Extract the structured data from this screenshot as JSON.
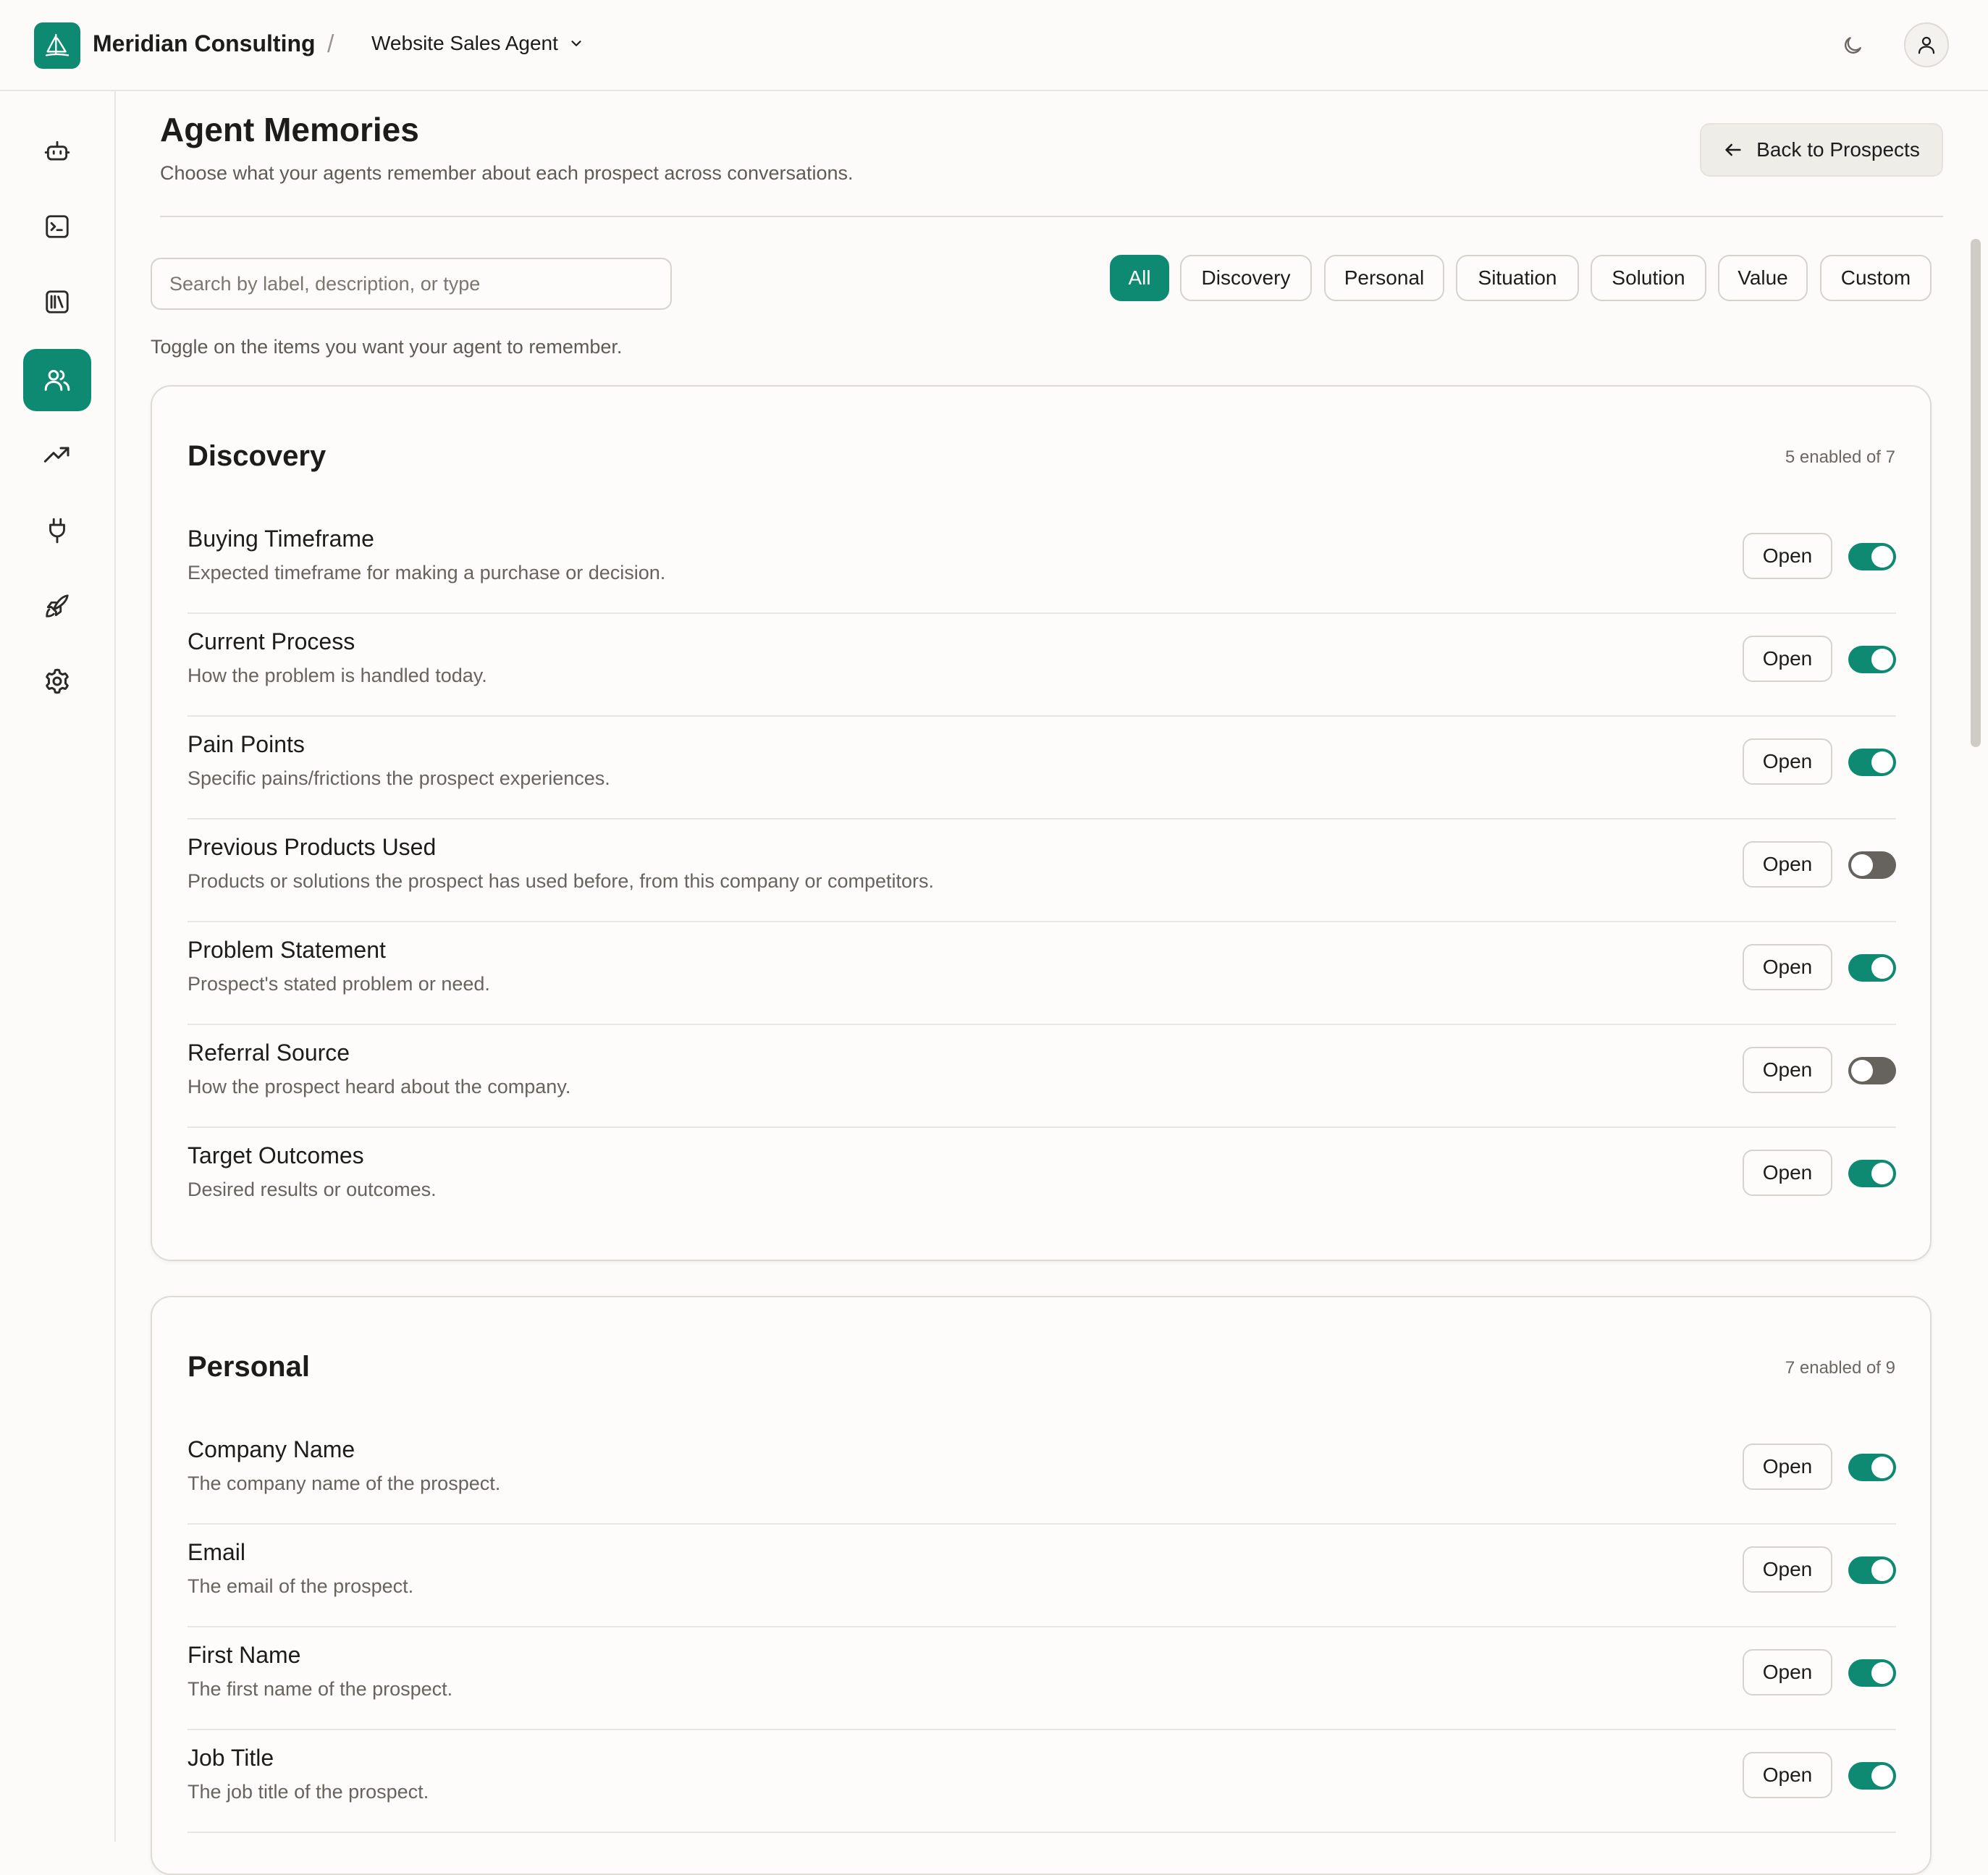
{
  "header": {
    "org_name": "Meridian Consulting",
    "separator": "/",
    "agent_name": "Website Sales Agent"
  },
  "sidebar": {
    "items": [
      {
        "icon": "bot-icon",
        "active": false
      },
      {
        "icon": "terminal-icon",
        "active": false
      },
      {
        "icon": "library-icon",
        "active": false
      },
      {
        "icon": "users-icon",
        "active": true
      },
      {
        "icon": "trending-up-icon",
        "active": false
      },
      {
        "icon": "plug-icon",
        "active": false
      },
      {
        "icon": "rocket-icon",
        "active": false
      },
      {
        "icon": "gear-icon",
        "active": false
      }
    ]
  },
  "page": {
    "title": "Agent Memories",
    "subtitle": "Choose what your agents remember about each prospect across conversations.",
    "back_label": "Back to Prospects"
  },
  "search": {
    "placeholder": "Search by label, description, or type",
    "value": ""
  },
  "filters": [
    {
      "label": "All",
      "active": true
    },
    {
      "label": "Discovery",
      "active": false
    },
    {
      "label": "Personal",
      "active": false
    },
    {
      "label": "Situation",
      "active": false
    },
    {
      "label": "Solution",
      "active": false
    },
    {
      "label": "Value",
      "active": false
    },
    {
      "label": "Custom",
      "active": false
    }
  ],
  "hint": "Toggle on the items you want your agent to remember.",
  "open_label": "Open",
  "groups": [
    {
      "title": "Discovery",
      "count": "5 enabled of 7",
      "items": [
        {
          "label": "Buying Timeframe",
          "description": "Expected timeframe for making a purchase or decision.",
          "enabled": true
        },
        {
          "label": "Current Process",
          "description": "How the problem is handled today.",
          "enabled": true
        },
        {
          "label": "Pain Points",
          "description": "Specific pains/frictions the prospect experiences.",
          "enabled": true
        },
        {
          "label": "Previous Products Used",
          "description": "Products or solutions the prospect has used before, from this company or competitors.",
          "enabled": false
        },
        {
          "label": "Problem Statement",
          "description": "Prospect's stated problem or need.",
          "enabled": true
        },
        {
          "label": "Referral Source",
          "description": "How the prospect heard about the company.",
          "enabled": false
        },
        {
          "label": "Target Outcomes",
          "description": "Desired results or outcomes.",
          "enabled": true
        }
      ]
    },
    {
      "title": "Personal",
      "count": "7 enabled of 9",
      "items": [
        {
          "label": "Company Name",
          "description": "The company name of the prospect.",
          "enabled": true
        },
        {
          "label": "Email",
          "description": "The email of the prospect.",
          "enabled": true
        },
        {
          "label": "First Name",
          "description": "The first name of the prospect.",
          "enabled": true
        },
        {
          "label": "Job Title",
          "description": "The job title of the prospect.",
          "enabled": true
        }
      ]
    }
  ],
  "colors": {
    "accent": "#0f8a72",
    "toggle_off": "#66635e",
    "background": "#fcfbf9"
  }
}
